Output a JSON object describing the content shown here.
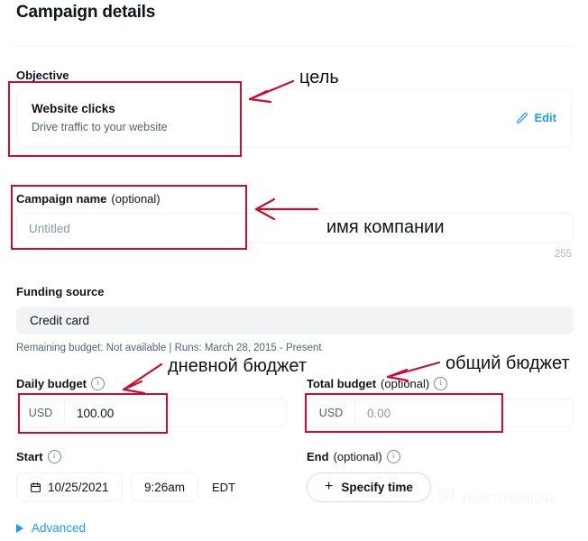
{
  "header": {
    "title": "Campaign details"
  },
  "objective": {
    "label": "Objective",
    "card_title": "Website clicks",
    "card_subtitle": "Drive traffic to your website",
    "edit_label": "Edit",
    "edit_icon": "pencil-icon",
    "edit_color": "#1d9bf0"
  },
  "campaign_name": {
    "label": "Campaign name",
    "optional": "(optional)",
    "value": "",
    "placeholder": "Untitled",
    "char_counter": "255"
  },
  "funding_source": {
    "label": "Funding source",
    "value": "Credit card",
    "note": "Remaining budget: Not available | Runs: March 28, 2015 - Present"
  },
  "daily_budget": {
    "label": "Daily budget",
    "info_icon": "info-icon",
    "currency": "USD",
    "value": "100.00",
    "placeholder": ""
  },
  "total_budget": {
    "label": "Total budget",
    "optional": "(optional)",
    "info_icon": "info-icon",
    "currency": "USD",
    "value": "",
    "placeholder": "0.00"
  },
  "start": {
    "label": "Start",
    "info_icon": "info-icon",
    "date": "10/25/2021",
    "date_icon": "calendar-icon",
    "time": "9:26am",
    "timezone": "EDT"
  },
  "end": {
    "label": "End",
    "optional": "(optional)",
    "info_icon": "info-icon",
    "specify_label": "Specify time",
    "specify_icon": "plus-icon"
  },
  "advanced": {
    "label": "Advanced",
    "icon": "triangle-right-icon",
    "color": "#1d9bf0"
  },
  "annotations": {
    "color": "#c8102e",
    "objective_note": "цель",
    "campaign_name_note": "имя компании",
    "daily_budget_note": "дневной бюджет",
    "total_budget_note": "общий бюджет"
  },
  "watermark": {
    "text": "ПАРТНЕРКИН",
    "icon": "chat-bubble-icon"
  }
}
